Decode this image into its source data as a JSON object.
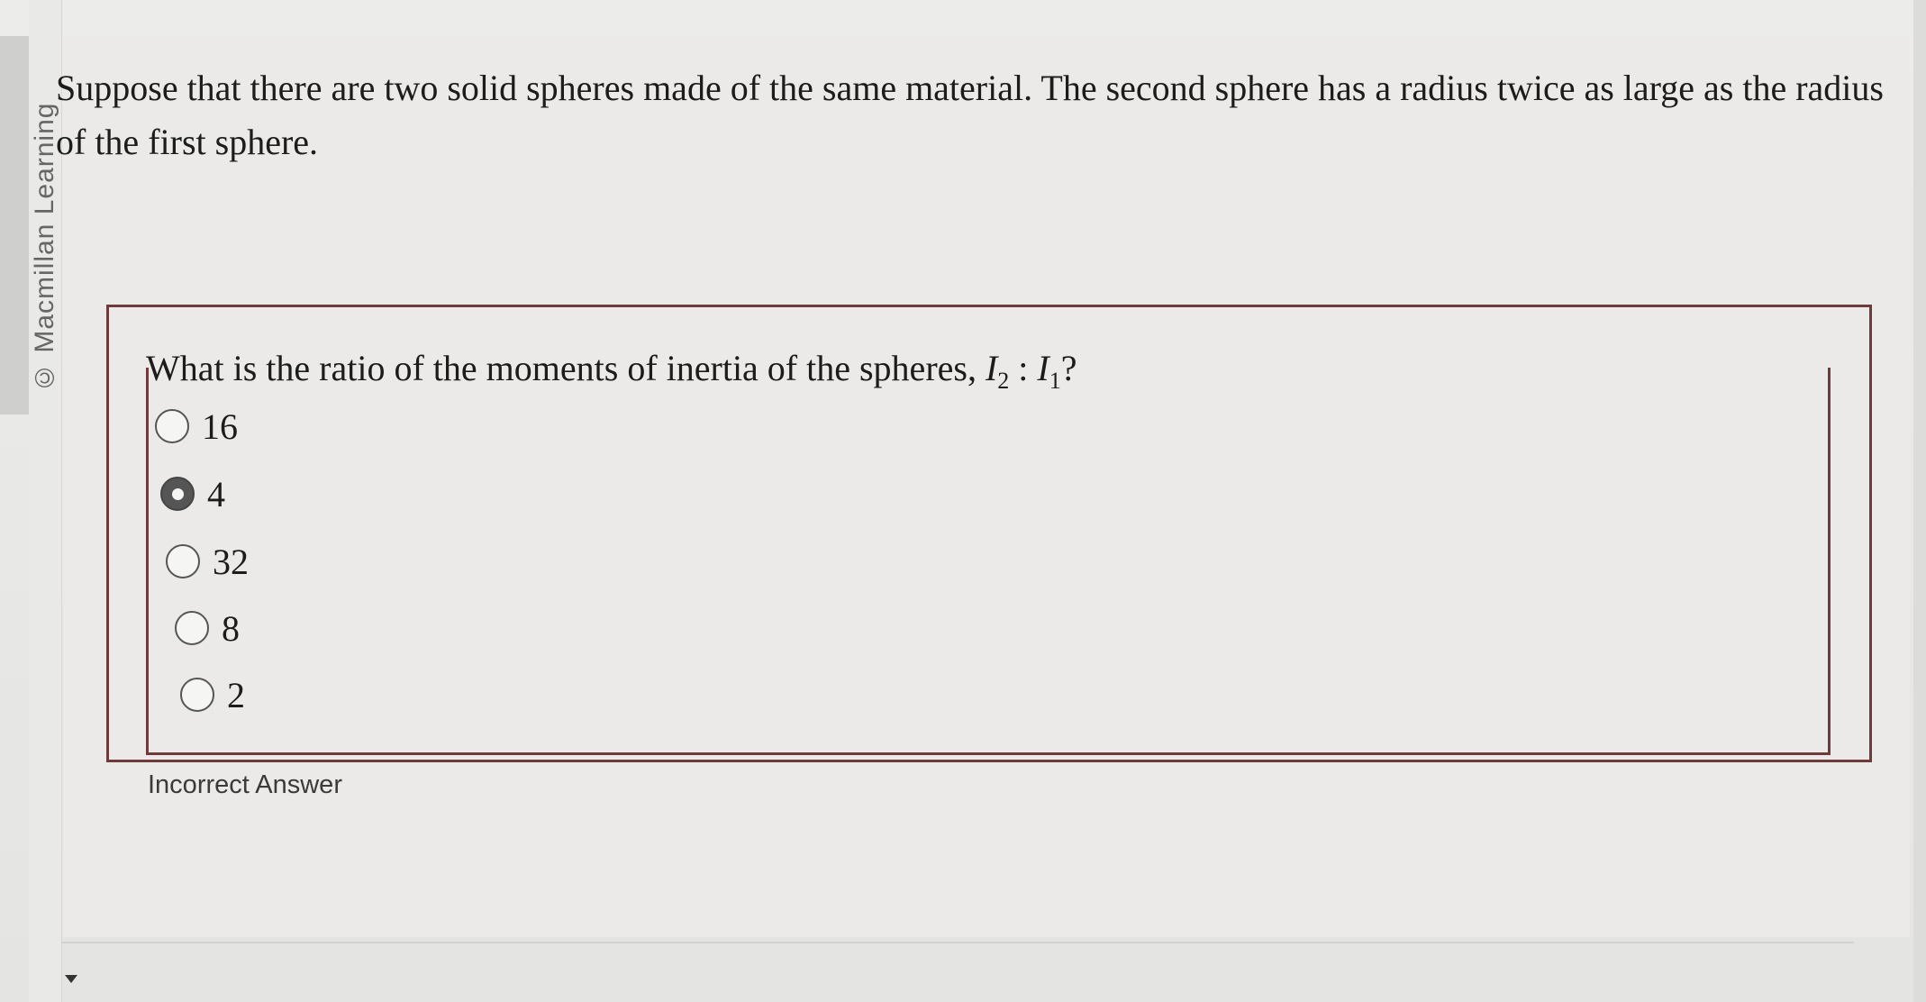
{
  "copyright": "© Macmillan Learning",
  "intro_text": "Suppose that there are two solid spheres made of the same material. The second sphere has a radius twice as large as the radius of the first sphere.",
  "question": {
    "prefix": "What is the ratio of the moments of inertia of the spheres, ",
    "symbol_a": "I",
    "sub_a": "2",
    "separator": " : ",
    "symbol_b": "I",
    "sub_b": "1",
    "suffix": "?"
  },
  "options": [
    {
      "label": "16",
      "selected": false
    },
    {
      "label": "4",
      "selected": true
    },
    {
      "label": "32",
      "selected": false
    },
    {
      "label": "8",
      "selected": false
    },
    {
      "label": "2",
      "selected": false
    }
  ],
  "feedback": "Incorrect Answer"
}
